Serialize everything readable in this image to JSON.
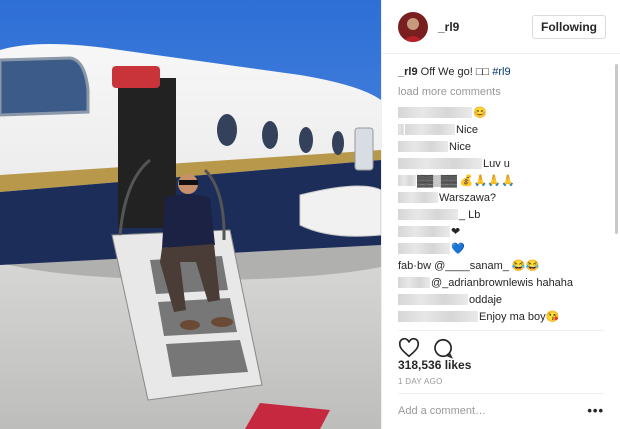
{
  "post": {
    "username": "_rl9",
    "follow_label": "Following",
    "caption_user": "_rl9",
    "caption_text": "Off We go! □□",
    "caption_hashtag": "#rl9",
    "load_more": "load more comments"
  },
  "comments": [
    {
      "text": "😊",
      "blur": [
        74
      ]
    },
    {
      "text": "Nice",
      "blur": [
        6,
        50
      ]
    },
    {
      "text": "Nice",
      "blur": [
        50
      ]
    },
    {
      "text": "Luv u",
      "blur": [
        84
      ]
    },
    {
      "text": "▓▓▒▓▓ 💰🙏🙏🙏",
      "blur": [
        18
      ]
    },
    {
      "text": "Warszawa?",
      "blur": [
        40
      ]
    },
    {
      "text": "_ Lb",
      "blur": [
        60
      ]
    },
    {
      "text": "❤",
      "blur": [
        52
      ]
    },
    {
      "text": "💙",
      "blur": [
        52
      ]
    },
    {
      "text": "fab·bw @____sanam_ 😂😂",
      "blur": []
    },
    {
      "text": "@_adrianbrownlewis hahaha",
      "blur": [
        32
      ]
    },
    {
      "text": "oddaje",
      "blur": [
        70
      ]
    },
    {
      "text": "Enjoy ma boy😘",
      "blur": [
        80
      ]
    },
    {
      "text": "",
      "blur": [
        120
      ]
    }
  ],
  "actions": {
    "like_icon": "heart-icon",
    "comment_icon": "speech-bubble-icon"
  },
  "likes_text": "318,536 likes",
  "time_text": "1 DAY AGO",
  "add_comment_placeholder": "Add a comment…",
  "more_label": "•••"
}
